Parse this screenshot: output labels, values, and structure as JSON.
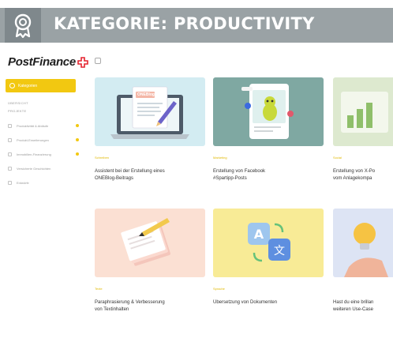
{
  "banner": {
    "title": "KATEGORIE: PRODUCTIVITY",
    "icon": "award-badge-icon",
    "background": "#9aa2a5"
  },
  "app": {
    "logo": {
      "text": "PostFinance",
      "mark": "swiss-cross-icon",
      "accent": "#e4222e"
    },
    "primary_color": "#f2c811",
    "sidebar": {
      "action_button": "Kategorien",
      "headings": [
        "ÜBERSICHT",
        "PROJEKTE"
      ],
      "items": [
        {
          "label": "Produktivität & Abläufe",
          "badge": true
        },
        {
          "label": "Produkt-Erweiterungen",
          "badge": true
        },
        {
          "label": "Immobilien-Finanzierung",
          "badge": true
        },
        {
          "label": "Versicherte Geschichten",
          "badge": false
        },
        {
          "label": "Entwürfe",
          "badge": false
        }
      ]
    },
    "cards": [
      {
        "tag": "Schreiben",
        "title_line1": "Assistent bei der Erstellung eines",
        "title_line2": "ONEBlog-Beitrags",
        "image_label": "ONEBlog",
        "image_bg": "#d3ecf2"
      },
      {
        "tag": "Marketing",
        "title_line1": "Erstellung von Facebook",
        "title_line2": "#Spartipp-Posts",
        "image_label": "",
        "image_bg": "#7fa8a2"
      },
      {
        "tag": "Social",
        "title_line1": "Erstellung von X-Po",
        "title_line2": "vom Anlagekompa",
        "image_label": "",
        "image_bg": "#dde9cf"
      },
      {
        "tag": "Texte",
        "title_line1": "Paraphrasierung & Verbesserung",
        "title_line2": "von Textinhalten",
        "image_label": "",
        "image_bg": "#fbe0d3"
      },
      {
        "tag": "Sprache",
        "title_line1": "Übersetzung von Dokumenten",
        "title_line2": "",
        "image_label": "",
        "image_bg": "#f8eb96"
      },
      {
        "tag": "",
        "title_line1": "Hast du eine brillan",
        "title_line2": "weiteren Use-Case",
        "image_label": "",
        "image_bg": "#dde4f4"
      }
    ]
  }
}
